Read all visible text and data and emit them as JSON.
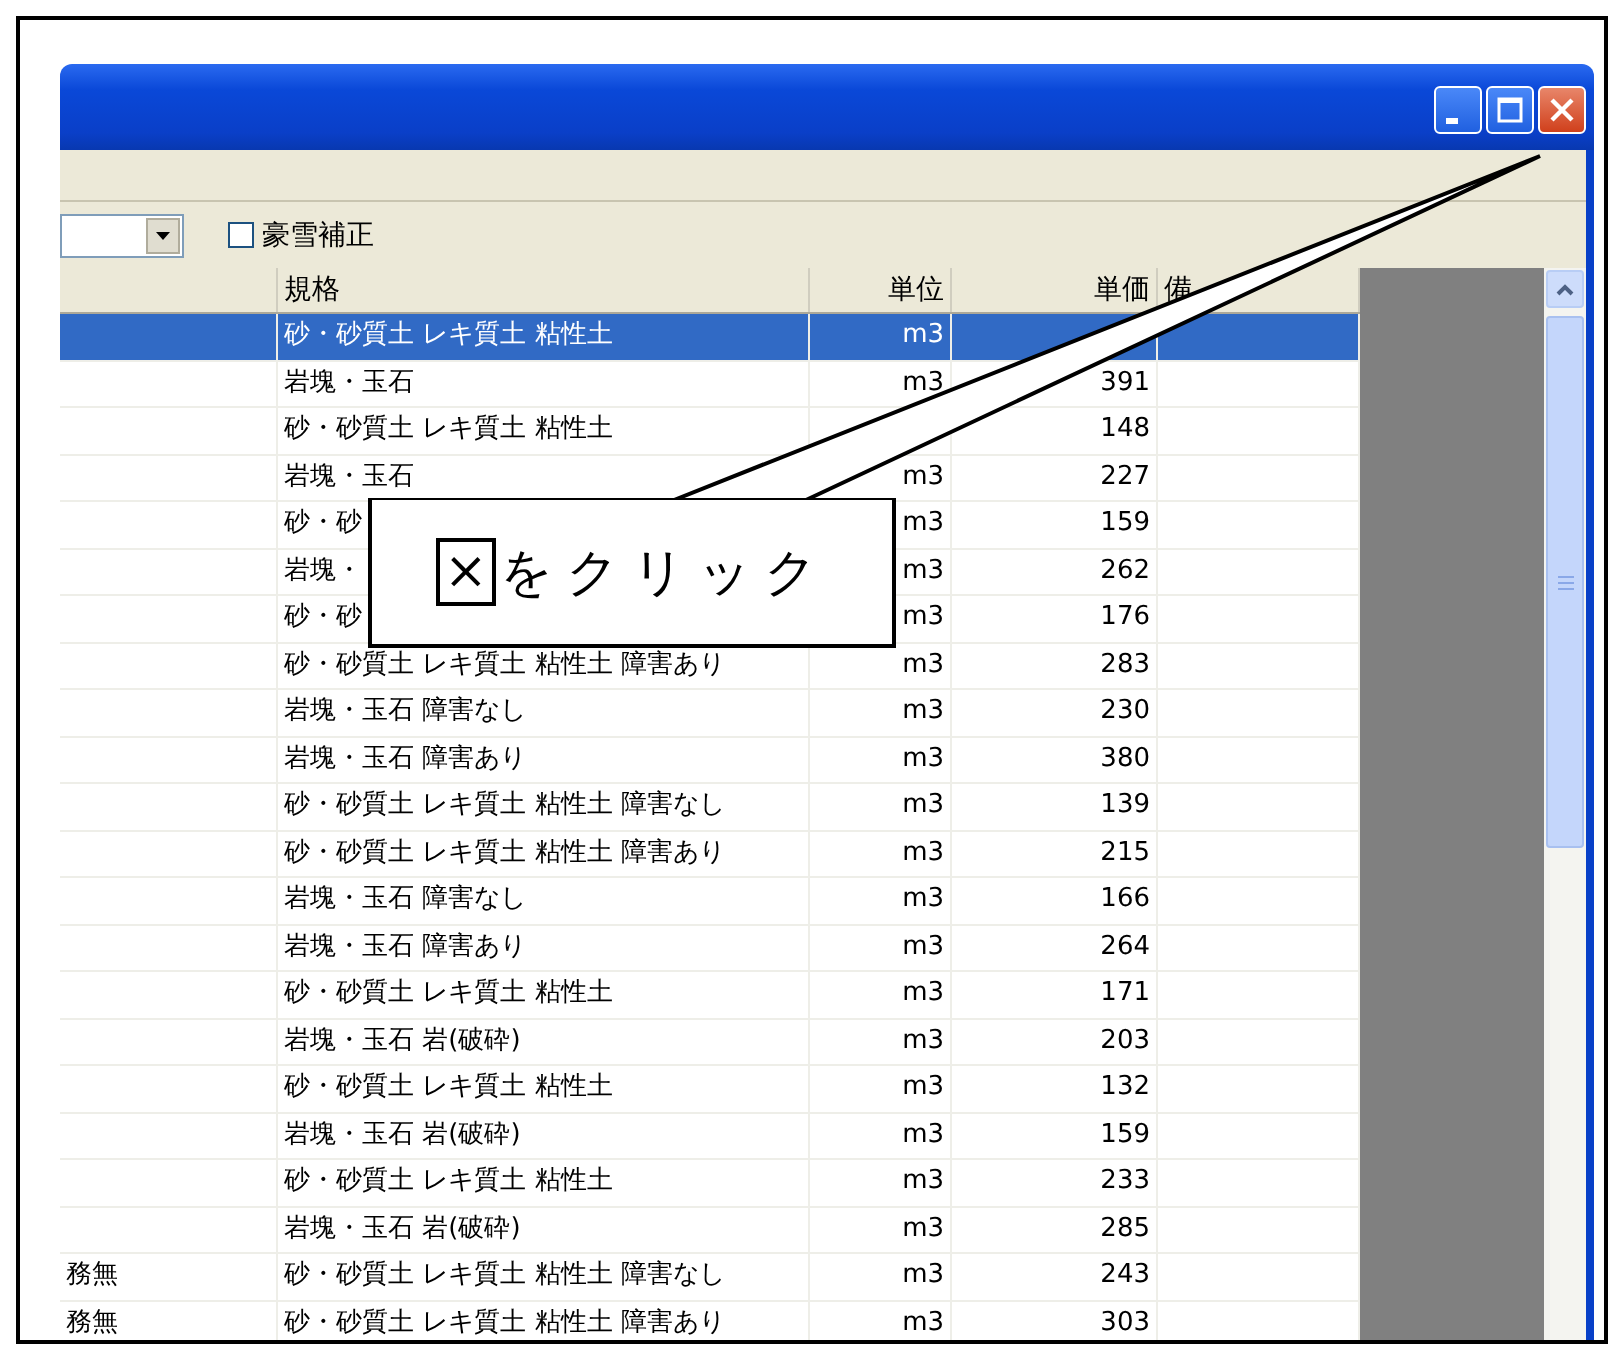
{
  "toolbar": {
    "snow_correction": {
      "label": "豪雪補正",
      "checked": false
    }
  },
  "table": {
    "columns": [
      "規格",
      "単位",
      "単価",
      "備"
    ],
    "rows": [
      {
        "spec": "砂・砂質土 レキ質土 粘性土",
        "unit": "m3",
        "selected": true
      },
      {
        "spec": "岩塊・玉石",
        "unit": "m3",
        "price": "391",
        "selected": false
      },
      {
        "spec": "砂・砂質土 レキ質土 粘性土",
        "price": "148",
        "selected": false
      },
      {
        "spec": "岩塊・玉石",
        "unit": "m3",
        "price": "227",
        "selected": false
      },
      {
        "spec": "砂・砂",
        "unit": "m3",
        "price": "159",
        "selected": false
      },
      {
        "spec": "岩塊・",
        "unit": "m3",
        "price": "262",
        "selected": false
      },
      {
        "spec": "砂・砂",
        "unit": "m3",
        "price": "176",
        "selected": false
      },
      {
        "spec": "砂・砂質土 レキ質土 粘性土 障害あり",
        "unit": "m3",
        "price": "283",
        "selected": false
      },
      {
        "spec": "岩塊・玉石 障害なし",
        "unit": "m3",
        "price": "230",
        "selected": false
      },
      {
        "spec": "岩塊・玉石 障害あり",
        "unit": "m3",
        "price": "380",
        "selected": false
      },
      {
        "spec": "砂・砂質土 レキ質土 粘性土 障害なし",
        "unit": "m3",
        "price": "139",
        "selected": false
      },
      {
        "spec": "砂・砂質土 レキ質土 粘性土 障害あり",
        "unit": "m3",
        "price": "215",
        "selected": false
      },
      {
        "spec": "岩塊・玉石 障害なし",
        "unit": "m3",
        "price": "166",
        "selected": false
      },
      {
        "spec": "岩塊・玉石 障害あり",
        "unit": "m3",
        "price": "264",
        "selected": false
      },
      {
        "spec": "砂・砂質土 レキ質土 粘性土",
        "unit": "m3",
        "price": "171",
        "selected": false
      },
      {
        "spec": "岩塊・玉石 岩(破砕)",
        "unit": "m3",
        "price": "203",
        "selected": false
      },
      {
        "spec": "砂・砂質土 レキ質土 粘性土",
        "unit": "m3",
        "price": "132",
        "selected": false
      },
      {
        "spec": "岩塊・玉石 岩(破砕)",
        "unit": "m3",
        "price": "159",
        "selected": false
      },
      {
        "spec": "砂・砂質土 レキ質土 粘性土",
        "unit": "m3",
        "price": "233",
        "selected": false
      },
      {
        "spec": "岩塊・玉石 岩(破砕)",
        "unit": "m3",
        "price": "285",
        "selected": false
      },
      {
        "column_1": "務無",
        "spec": "砂・砂質土 レキ質土 粘性土 障害なし",
        "unit": "m3",
        "price": "243",
        "selected": false
      },
      {
        "column_1": "務無",
        "spec": "砂・砂質土 レキ質土 粘性土 障害あり",
        "unit": "m3",
        "price": "303",
        "selected": false
      }
    ]
  },
  "callout": {
    "symbol": "×",
    "text": "をクリック"
  }
}
